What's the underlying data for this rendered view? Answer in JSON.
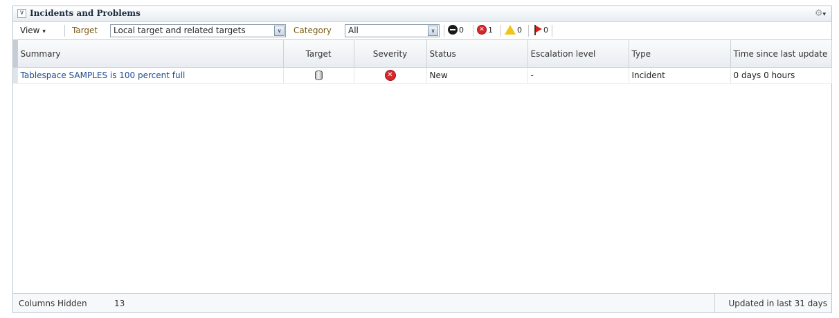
{
  "panel": {
    "collapse_glyph": "∨",
    "title": "Incidents and Problems",
    "gear_glyph": "⚙",
    "gear_caret": "▾"
  },
  "toolbar": {
    "view_label": "View",
    "view_caret": "▾",
    "target_label": "Target",
    "target_value": "Local target and related targets",
    "category_label": "Category",
    "category_value": "All",
    "dropdown_arrow": "∨",
    "counts": {
      "cleared": "0",
      "critical": "1",
      "warning": "0",
      "escalated": "0"
    }
  },
  "table": {
    "columns": [
      "Summary",
      "Target",
      "Severity",
      "Status",
      "Escalation level",
      "Type",
      "Time since last update"
    ],
    "rows": [
      {
        "summary": "Tablespace SAMPLES is 100 percent full",
        "target_icon": "database-icon",
        "severity_icon": "critical-icon",
        "severity_glyph": "✕",
        "status": "New",
        "escalation": "-",
        "type": "Incident",
        "time": "0 days 0 hours"
      }
    ]
  },
  "footer": {
    "columns_hidden_label": "Columns Hidden",
    "columns_hidden_count": "13",
    "updated_text": "Updated in last 31 days"
  },
  "colors": {
    "link": "#1a4a8e",
    "critical": "#d42a2e",
    "warning": "#f0c419",
    "label_accent": "#7a5a10"
  }
}
